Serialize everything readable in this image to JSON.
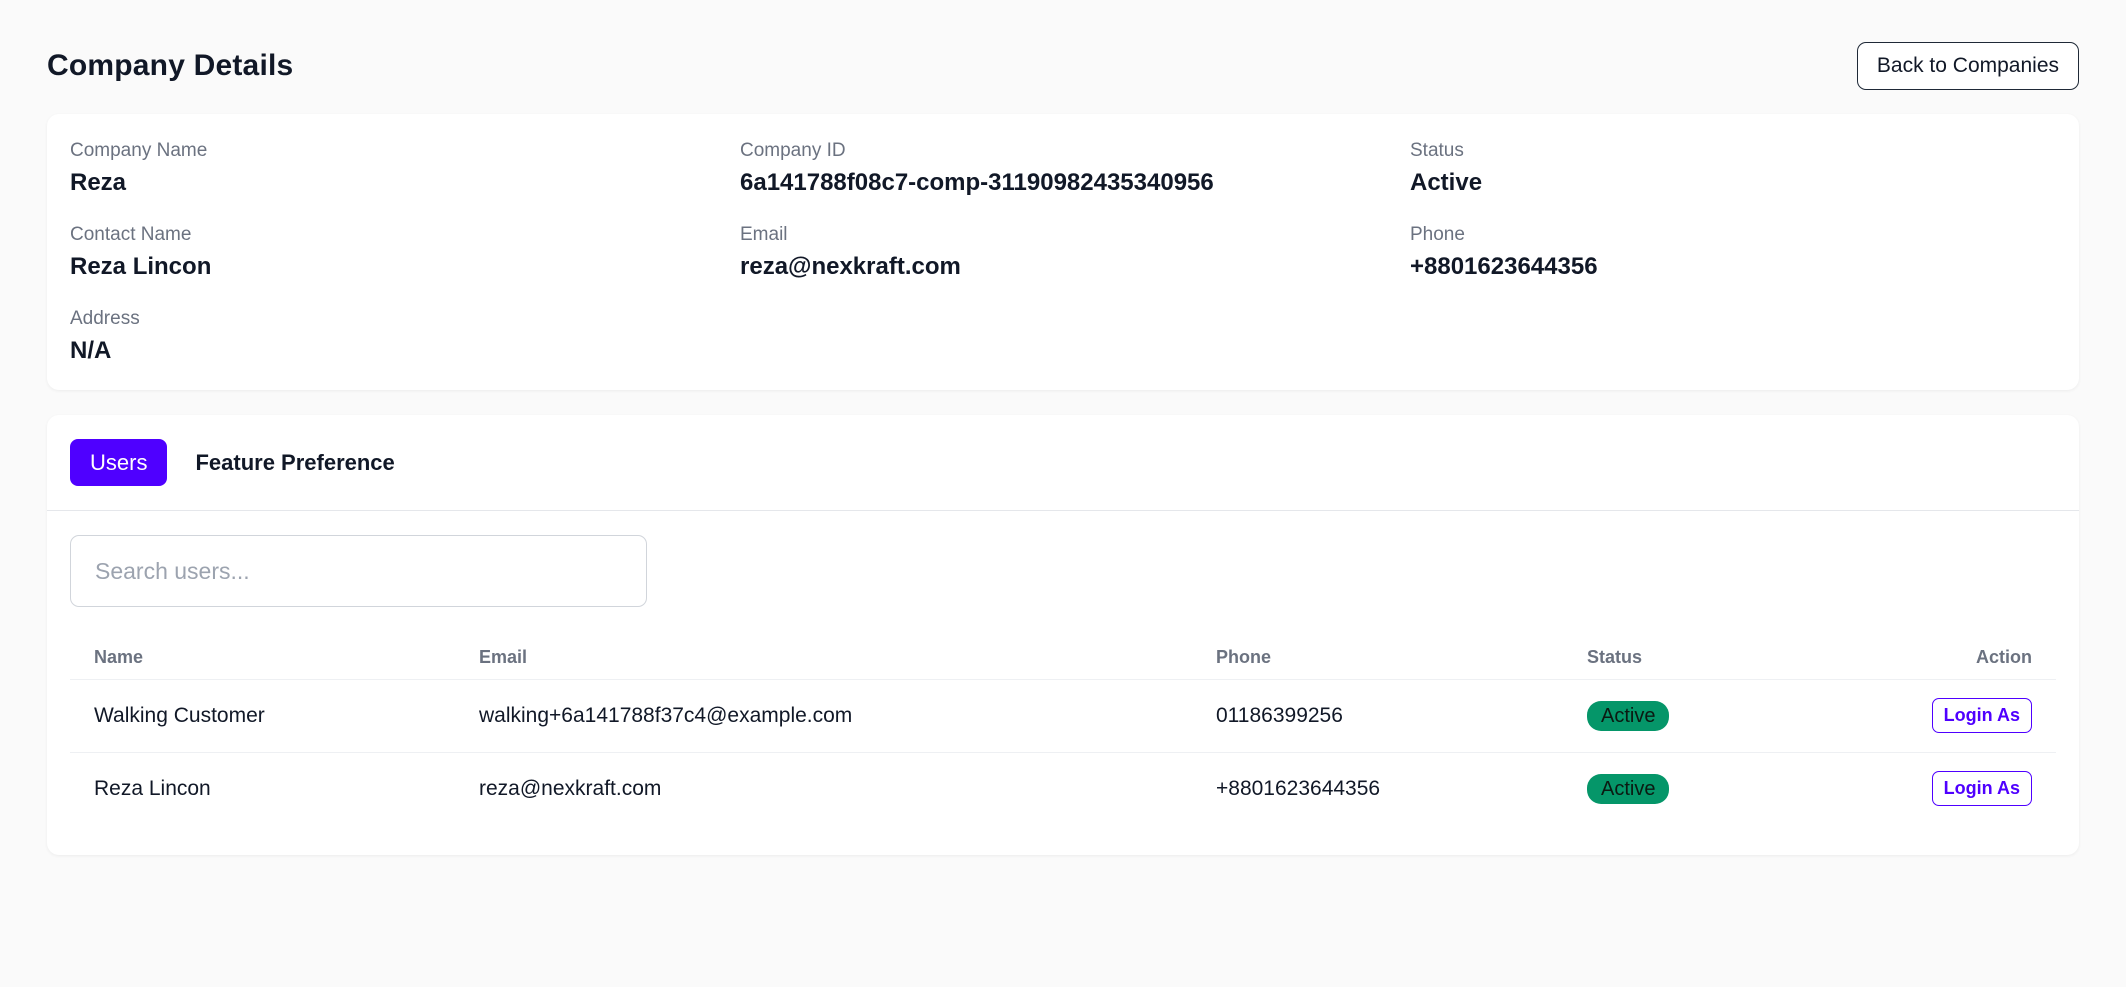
{
  "header": {
    "title": "Company Details",
    "back_label": "Back to Companies"
  },
  "details": {
    "company_name": {
      "label": "Company Name",
      "value": "Reza"
    },
    "company_id": {
      "label": "Company ID",
      "value": "6a141788f08c7-comp-31190982435340956"
    },
    "status": {
      "label": "Status",
      "value": "Active"
    },
    "contact_name": {
      "label": "Contact Name",
      "value": "Reza Lincon"
    },
    "email": {
      "label": "Email",
      "value": "reza@nexkraft.com"
    },
    "phone": {
      "label": "Phone",
      "value": "+8801623644356"
    },
    "address": {
      "label": "Address",
      "value": "N/A"
    }
  },
  "tabs": [
    {
      "label": "Users",
      "active": true
    },
    {
      "label": "Feature Preference",
      "active": false
    }
  ],
  "search": {
    "placeholder": "Search users...",
    "value": ""
  },
  "users_table": {
    "columns": {
      "name": "Name",
      "email": "Email",
      "phone": "Phone",
      "status": "Status",
      "action": "Action"
    },
    "rows": [
      {
        "name": "Walking Customer",
        "email": "walking+6a141788f37c4@example.com",
        "phone": "01186399256",
        "status": "Active",
        "action": "Login As"
      },
      {
        "name": "Reza Lincon",
        "email": "reza@nexkraft.com",
        "phone": "+8801623644356",
        "status": "Active",
        "action": "Login As"
      }
    ]
  },
  "colors": {
    "accent": "#4f00ff",
    "status_active": "#059669",
    "background": "#fafafa"
  }
}
